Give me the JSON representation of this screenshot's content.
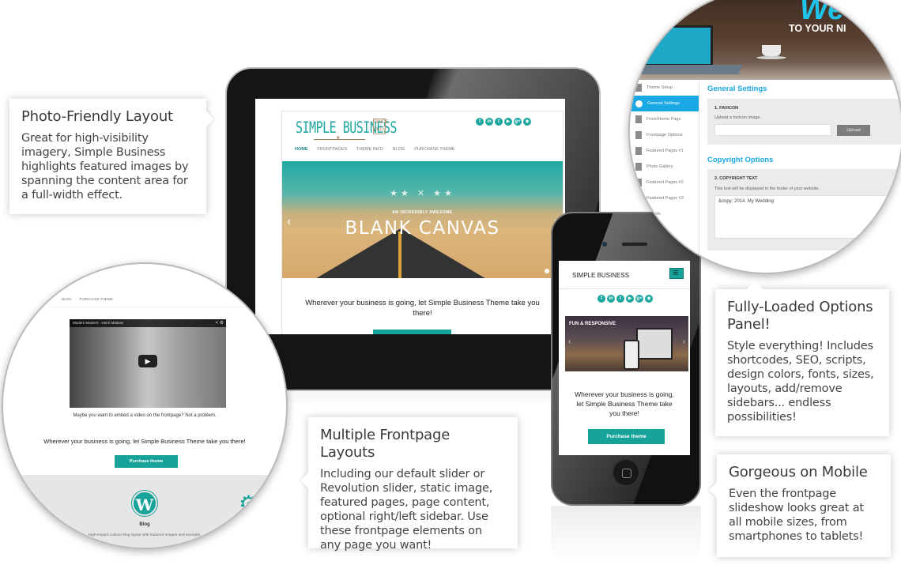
{
  "callouts": {
    "photo": {
      "title": "Photo-Friendly Layout",
      "body": "Great for high-visibility imagery, Simple Business highlights featured images by spanning the content area for a full-width effect."
    },
    "options": {
      "title": "Fully-Loaded Options Panel!",
      "body": "Style everything! Includes shortcodes, SEO, scripts, design colors, fonts, sizes, layouts, add/remove sidebars... endless possibilities!"
    },
    "mobile": {
      "title": "Gorgeous on Mobile",
      "body": "Even the frontpage slideshow looks great at all mobile sizes, from smartphones to tablets!"
    },
    "frontpage": {
      "title": "Multiple Frontpage Layouts",
      "body": "Including our default slider or Revolution slider, static image, featured pages, page content, optional right/left sidebar. Use these frontpage elements on any page you want!"
    }
  },
  "tablet_site": {
    "logo": "SIMPLE BUSINESS",
    "logo_badge": "SINCE 2015",
    "social_icons": [
      {
        "name": "facebook-icon",
        "glyph": "f"
      },
      {
        "name": "linkedin-icon",
        "glyph": "in"
      },
      {
        "name": "twitter-icon",
        "glyph": "t"
      },
      {
        "name": "youtube-icon",
        "glyph": "▶"
      },
      {
        "name": "googleplus-icon",
        "glyph": "g+"
      },
      {
        "name": "rss-icon",
        "glyph": "◉"
      }
    ],
    "nav": [
      "HOME",
      "FRONTPAGES",
      "THEME INFO",
      "BLOG",
      "PURCHASE THEME"
    ],
    "slider": {
      "stars": "★★ ✕ ★★",
      "kicker": "AN INCREDIBLY AWESOME",
      "headline": "BLANK CANVAS",
      "prev": "‹",
      "next": "›"
    },
    "tagline": "Wherever your business is going, let Simple Business Theme take you there!"
  },
  "phone_site": {
    "title": "SIMPLE BUSINESS",
    "slider_text": "FUN & RESPONSIVE",
    "prev": "‹",
    "next": "›",
    "tagline": "Wherever your business is going, let Simple Business Theme take you there!",
    "cta": "Purchase theme"
  },
  "admin_panel": {
    "hero_big": "We",
    "hero_sub": "TO YOUR NI",
    "sidebar": [
      {
        "label": "Theme Setup",
        "icon": "wrench-icon",
        "active": false
      },
      {
        "label": "General Settings",
        "icon": "gears-icon",
        "active": true
      },
      {
        "label": "Front/Home Page",
        "icon": "page-icon",
        "active": false
      },
      {
        "label": "Frontpage Options",
        "icon": "code-file-icon",
        "active": false
      },
      {
        "label": "Featured Pages #1",
        "icon": "document-icon",
        "active": false
      },
      {
        "label": "Photo Gallery",
        "icon": "image-icon",
        "active": false
      },
      {
        "label": "Featured Pages #2",
        "icon": "documents-icon",
        "active": false
      },
      {
        "label": "Featured Pages #3",
        "icon": "documents-icon",
        "active": false
      },
      {
        "label": "VP Info",
        "icon": "info-icon",
        "active": false
      }
    ],
    "general_heading": "General Settings",
    "favicon_label": "1. FAVICON",
    "favicon_desc": "Upload a favicon image.",
    "favicon_value": "",
    "upload_label": "Upload",
    "copyright_heading": "Copyright Options",
    "copyright_label": "2. COPYRIGHT TEXT",
    "copyright_desc": "This text will be displayed in the footer of your website.",
    "copyright_value": "&copy; 2014. My Wedding"
  },
  "video_lens": {
    "nav": [
      "BLOG",
      "PURCHASE THEME"
    ],
    "video_title": "Modern Masters - Henri Matisse",
    "video_icons": "< ⚙",
    "play": "▶",
    "caption": "Maybe you want to embed a video on the frontpage? Not a problem.",
    "tagline": "Wherever your business is going, let Simple Business Theme take you there!",
    "cta": "Purchase theme",
    "feature_title": "Blog",
    "feature_desc": "High-impact custom blog layout with featured images and excerpts."
  },
  "colors": {
    "brand_teal": "#17a29a",
    "admin_blue": "#19a8e4"
  }
}
